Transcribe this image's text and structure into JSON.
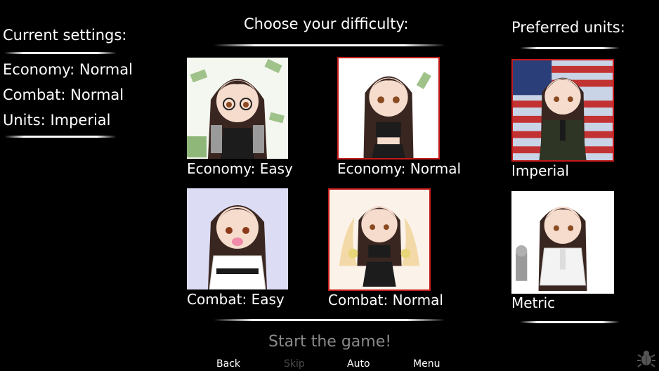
{
  "settings": {
    "title": "Current settings:",
    "economy": "Economy: Normal",
    "combat": "Combat: Normal",
    "units": "Units: Imperial"
  },
  "difficulty": {
    "title": "Choose your difficulty:",
    "options": [
      {
        "label": "Economy: Easy",
        "selected": false,
        "bg": "#f4f7ef"
      },
      {
        "label": "Economy: Normal",
        "selected": true,
        "bg": "#ffffff"
      },
      {
        "label": "Combat: Easy",
        "selected": false,
        "bg": "#dcdcf4"
      },
      {
        "label": "Combat: Normal",
        "selected": true,
        "bg": "#fbf3ea"
      }
    ]
  },
  "units": {
    "title": "Preferred units:",
    "options": [
      {
        "label": "Imperial",
        "selected": true,
        "bg": "#c9d4e6"
      },
      {
        "label": "Metric",
        "selected": false,
        "bg": "#ffffff"
      }
    ]
  },
  "start_label": "Start the game!",
  "quick_menu": {
    "back": "Back",
    "skip": "Skip",
    "auto": "Auto",
    "menu": "Menu"
  },
  "colors": {
    "selected_border": "#c41a1a",
    "disabled_text": "#4a4a4a",
    "start_text": "#8a8a8a"
  },
  "icons": {
    "debug": "bug-icon"
  }
}
